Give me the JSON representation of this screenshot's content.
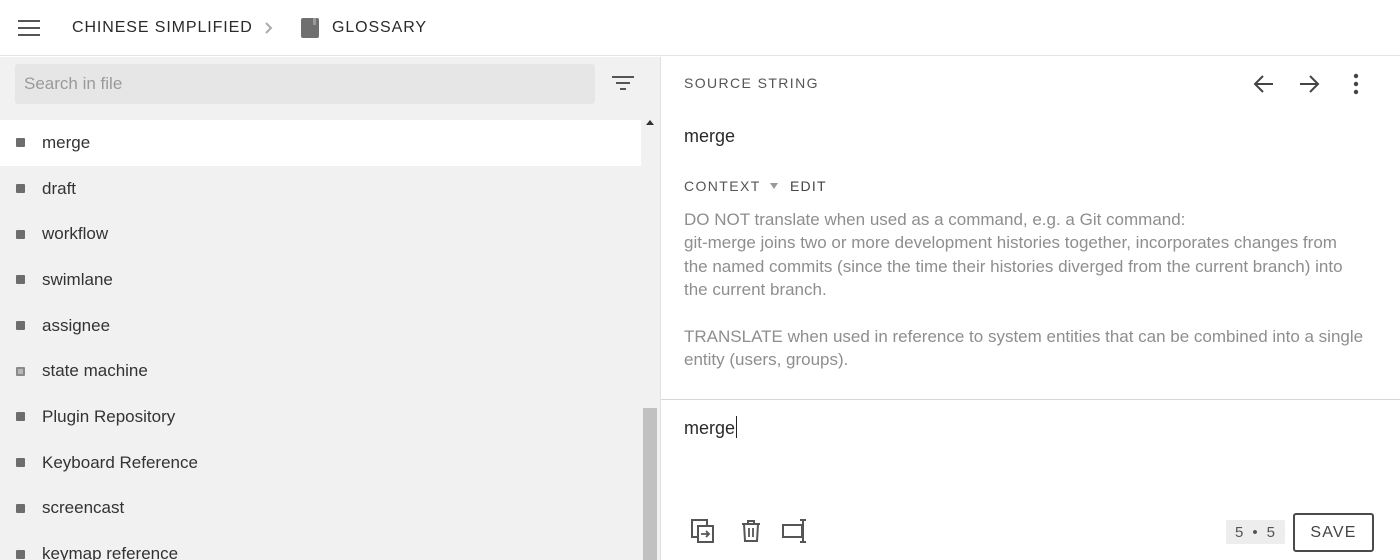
{
  "header": {
    "project": "CHINESE SIMPLIFIED",
    "file": "GLOSSARY"
  },
  "search": {
    "placeholder": "Search in file",
    "value": ""
  },
  "strings": [
    {
      "label": "merge",
      "active": true,
      "status": "untranslated"
    },
    {
      "label": "draft",
      "active": false,
      "status": "untranslated"
    },
    {
      "label": "workflow",
      "active": false,
      "status": "untranslated"
    },
    {
      "label": "swimlane",
      "active": false,
      "status": "untranslated"
    },
    {
      "label": "assignee",
      "active": false,
      "status": "untranslated"
    },
    {
      "label": "state machine",
      "active": false,
      "status": "partial"
    },
    {
      "label": "Plugin Repository",
      "active": false,
      "status": "untranslated"
    },
    {
      "label": "Keyboard Reference",
      "active": false,
      "status": "untranslated"
    },
    {
      "label": "screencast",
      "active": false,
      "status": "untranslated"
    },
    {
      "label": "keymap reference",
      "active": false,
      "status": "untranslated"
    }
  ],
  "editor": {
    "source_label": "SOURCE STRING",
    "source_text": "merge",
    "context_label": "CONTEXT",
    "edit_label": "EDIT",
    "context_paragraph_1": "DO NOT translate when used as a command, e.g. a Git command:",
    "context_paragraph_2": "git-merge joins two or more development histories together, incorporates changes from the named commits (since the time their histories diverged from the current branch) into the current branch.",
    "context_paragraph_3": "TRANSLATE when used in reference to system entities that can be combined into a single entity (users, groups).",
    "translation_value": "merge",
    "counter_left": "5",
    "counter_dot": "•",
    "counter_right": "5",
    "save_label": "SAVE"
  },
  "colors": {
    "accent_border": "#4a4a4a",
    "panel_bg": "#f1f1f1",
    "active_row": "#ffffff"
  },
  "icons": [
    "menu-icon",
    "chevron-right-icon",
    "file-icon",
    "filter-icon",
    "arrow-left-icon",
    "arrow-right-icon",
    "more-vert-icon",
    "caret-down-icon",
    "copy-source-icon",
    "delete-icon",
    "insert-tag-icon"
  ]
}
